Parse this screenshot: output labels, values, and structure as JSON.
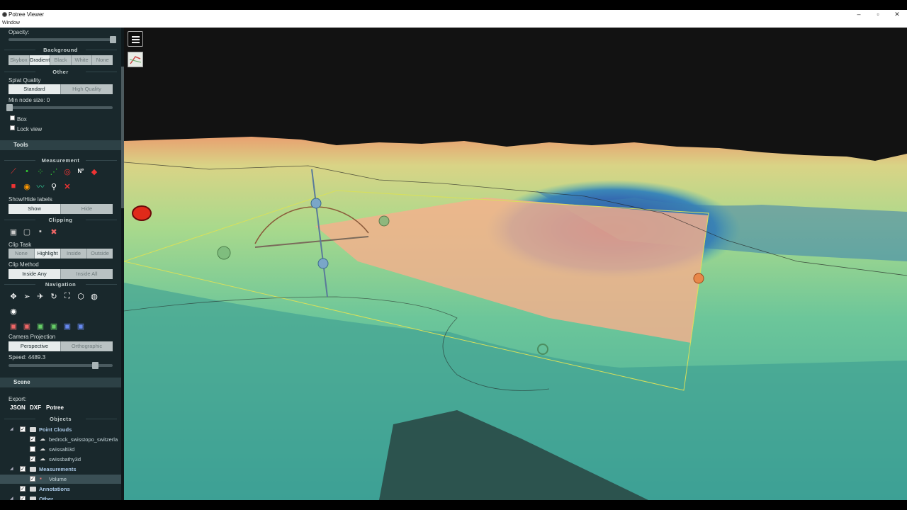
{
  "window": {
    "title": "Potree Viewer",
    "menu": "Window",
    "minimize": "–",
    "maximize": "▫",
    "close": "✕"
  },
  "appearance": {
    "opacity_label": "Opacity:",
    "background_title": "Background",
    "background_options": [
      "Skybox",
      "Gradient",
      "Black",
      "White",
      "None"
    ],
    "background_selected": "Gradient",
    "other_title": "Other",
    "splat_label": "Splat Quality",
    "splat_options": [
      "Standard",
      "High Quality"
    ],
    "splat_selected": "Standard",
    "min_node_label": "Min node size: 0",
    "box_label": "Box",
    "lock_view_label": "Lock view"
  },
  "tools": {
    "header": "Tools",
    "measurement_title": "Measurement",
    "labels_title": "Show/Hide labels",
    "labels_options": [
      "Show",
      "Hide"
    ],
    "labels_selected": "Show",
    "clipping_title": "Clipping",
    "clip_task_label": "Clip Task",
    "clip_task_options": [
      "None",
      "Highlight",
      "Inside",
      "Outside"
    ],
    "clip_task_selected": "Highlight",
    "clip_method_label": "Clip Method",
    "clip_method_options": [
      "Inside Any",
      "Inside All"
    ],
    "clip_method_selected": "Inside Any",
    "navigation_title": "Navigation",
    "camera_label": "Camera Projection",
    "camera_options": [
      "Perspective",
      "Orthographic"
    ],
    "camera_selected": "Perspective",
    "speed_label": "Speed: 4489.3"
  },
  "scene": {
    "header": "Scene",
    "export_label": "Export:",
    "export_options": [
      "JSON",
      "DXF",
      "Potree"
    ],
    "objects_title": "Objects",
    "tree": [
      {
        "label": "Point Clouds",
        "level": 0,
        "checked": true,
        "kind": "folder"
      },
      {
        "label": "bedrock_swisstopo_switzerla",
        "level": 1,
        "checked": true,
        "kind": "cloud"
      },
      {
        "label": "swissalti3d",
        "level": 1,
        "checked": false,
        "kind": "cloud"
      },
      {
        "label": "swissbathy3d",
        "level": 1,
        "checked": true,
        "kind": "cloud"
      },
      {
        "label": "Measurements",
        "level": 0,
        "checked": true,
        "kind": "folder"
      },
      {
        "label": "Volume",
        "level": 1,
        "checked": true,
        "kind": "volume",
        "selected": true
      },
      {
        "label": "Annotations",
        "level": 0,
        "checked": true,
        "kind": "folder"
      },
      {
        "label": "Other",
        "level": 0,
        "checked": true,
        "kind": "folder"
      }
    ]
  },
  "viewport": {
    "sky_color": "#141414",
    "accent_clip_box": "#d8e05a",
    "highlight_color": "#f5b08c"
  }
}
